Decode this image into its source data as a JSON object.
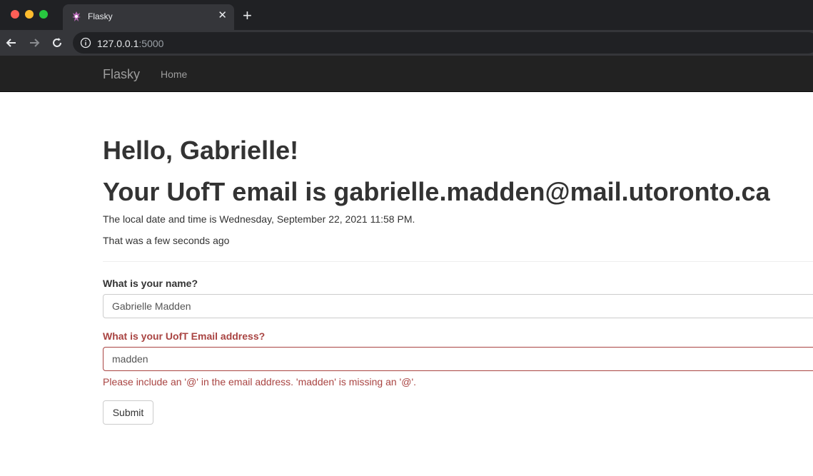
{
  "browser": {
    "tab_title": "Flasky",
    "tab_close_icon": "close-icon",
    "new_tab_icon": "plus-icon",
    "url_host": "127.0.0.1",
    "url_port": ":5000",
    "colors": {
      "chrome_dark": "#202124",
      "chrome_toolbar": "#35363a"
    }
  },
  "navbar": {
    "brand": "Flasky",
    "items": [
      {
        "label": "Home"
      }
    ],
    "colors": {
      "background": "#222222",
      "text": "#9d9d9d"
    }
  },
  "main": {
    "greeting": "Hello, Gabrielle!",
    "email_heading": "Your UofT email is gabrielle.madden@mail.utoronto.ca",
    "local_time_text": "The local date and time is Wednesday, September 22, 2021 11:58 PM.",
    "relative_time_text": "That was a few seconds ago"
  },
  "form": {
    "name_label": "What is your name?",
    "name_value": "Gabrielle Madden",
    "email_label": "What is your UofT Email address?",
    "email_value": "madden",
    "email_error": "Please include an '@' in the email address. 'madden' is missing an '@'.",
    "submit_label": "Submit",
    "colors": {
      "error": "#a94442",
      "border": "#cccccc"
    }
  }
}
